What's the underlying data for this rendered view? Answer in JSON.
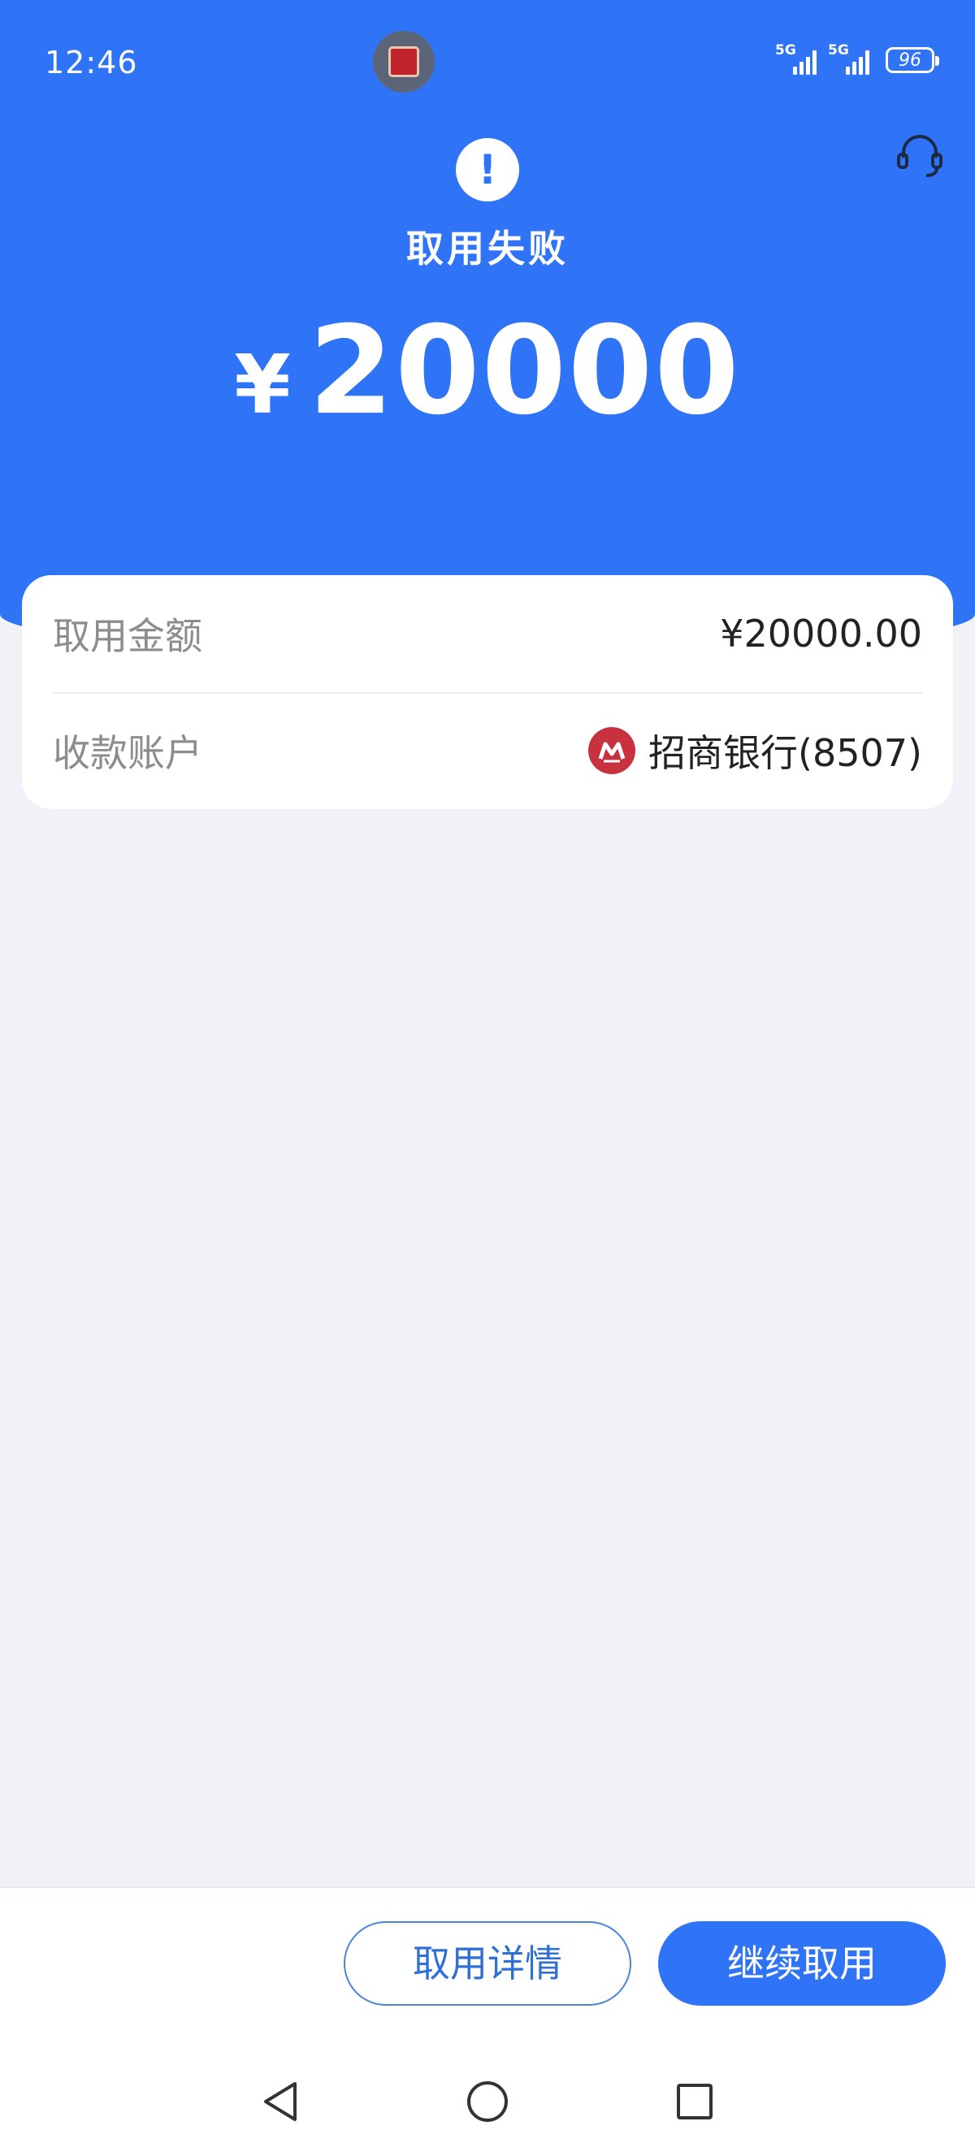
{
  "status_bar": {
    "time": "12:46",
    "network_1": "5G",
    "network_2": "5G",
    "battery": "96"
  },
  "header": {
    "status_icon": "!",
    "title": "取用失败",
    "currency_symbol": "¥",
    "amount": "20000",
    "support_icon": "headset-icon"
  },
  "details": {
    "rows": [
      {
        "label": "取用金额",
        "value": "¥20000.00"
      },
      {
        "label": "收款账户",
        "value": "招商银行(8507)",
        "icon": "cmb-bank-logo"
      }
    ]
  },
  "actions": {
    "detail_label": "取用详情",
    "continue_label": "继续取用"
  },
  "nav": {
    "back_icon": "triangle-back-icon",
    "home_icon": "circle-home-icon",
    "recent_icon": "square-recent-icon"
  },
  "colors": {
    "primary": "#2f73f7",
    "background": "#f0f2f7",
    "bank_red": "#c8323e"
  }
}
